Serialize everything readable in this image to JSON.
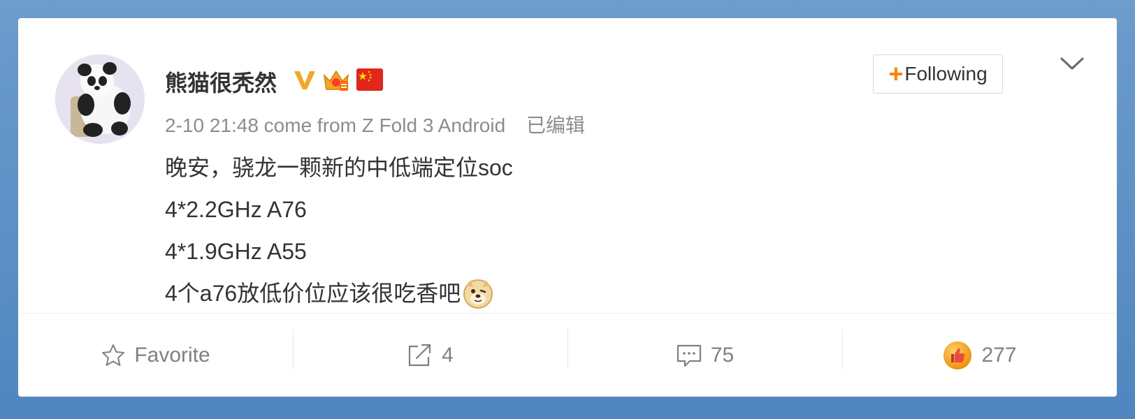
{
  "post": {
    "username": "熊猫很秃然",
    "timestamp": "2-10 21:48",
    "source": "come from Z Fold 3 Android",
    "edited_label": "已编辑",
    "content_lines": [
      "晚安，骁龙一颗新的中低端定位soc",
      "4*2.2GHz A76",
      "4*1.9GHz A55",
      "4个a76放低价位应该很吃香吧"
    ],
    "badges": [
      "verified-v-icon",
      "crown-member-icon",
      "china-flag-icon"
    ]
  },
  "follow_button": {
    "plus": "+",
    "label": "Following"
  },
  "actions": {
    "favorite_label": "Favorite",
    "repost_count": "4",
    "comment_count": "75",
    "like_count": "277"
  },
  "colors": {
    "background": "#5b8fc4",
    "accent": "#ff8200",
    "text": "#333333",
    "meta": "#8c8c8c"
  }
}
